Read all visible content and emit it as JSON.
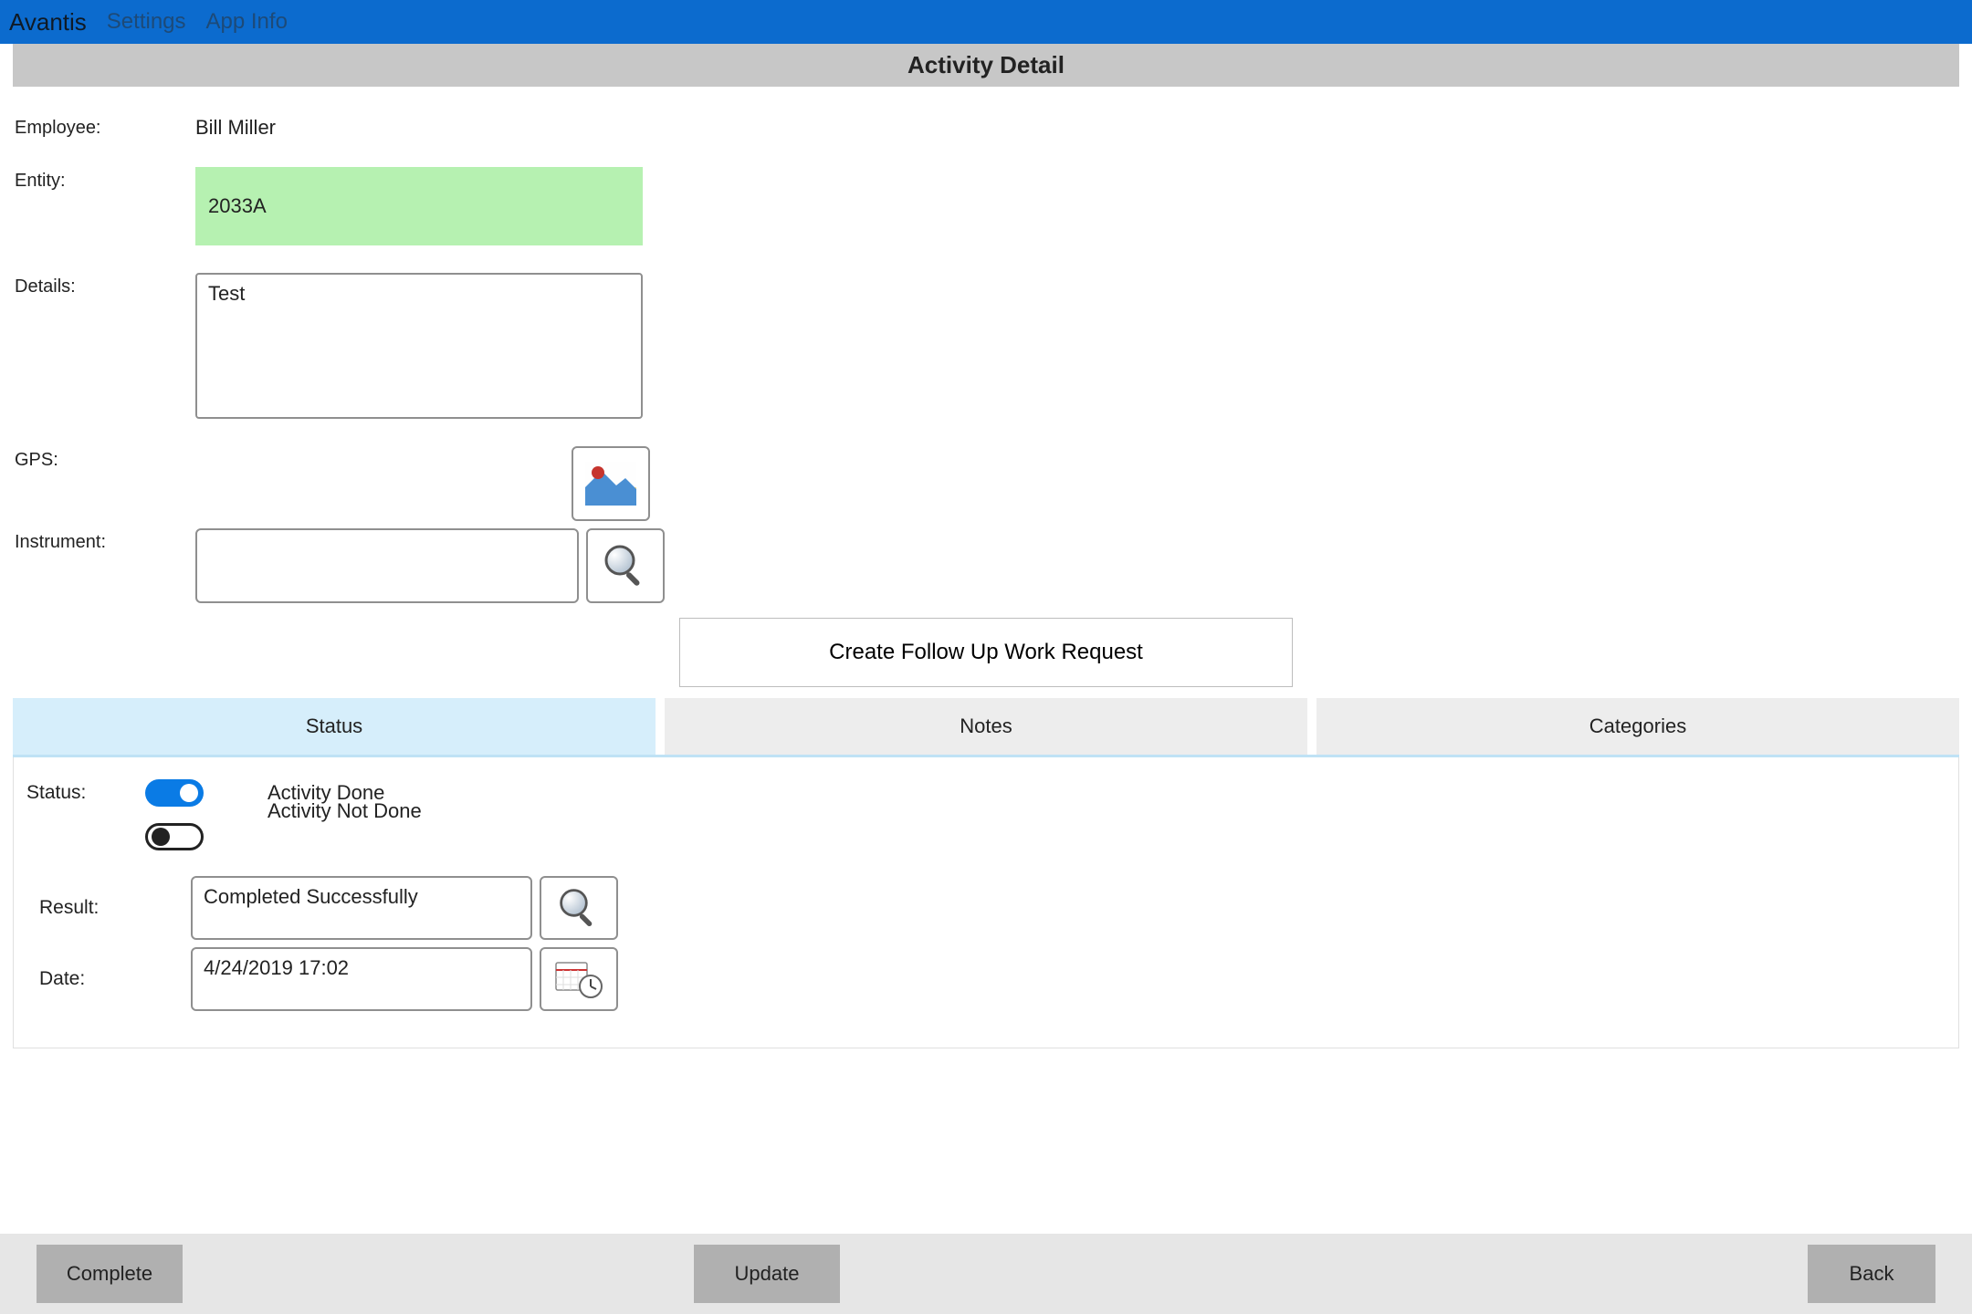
{
  "titlebar": {
    "app": "Avantis",
    "menu_settings": "Settings",
    "menu_appinfo": "App Info"
  },
  "header": {
    "title": "Activity Detail"
  },
  "form": {
    "employee_label": "Employee:",
    "employee_value": "Bill Miller",
    "entity_label": "Entity:",
    "entity_value": "2033A",
    "details_label": "Details:",
    "details_value": "Test",
    "gps_label": "GPS:",
    "instrument_label": "Instrument:",
    "instrument_value": "",
    "followup_label": "Create Follow Up Work Request"
  },
  "tabs": {
    "status": "Status",
    "notes": "Notes",
    "categories": "Categories"
  },
  "status": {
    "label": "Status:",
    "done_text": "Activity Done",
    "notdone_text": "Activity Not Done",
    "result_label": "Result:",
    "result_value": "Completed Successfully",
    "date_label": "Date:",
    "date_value": "4/24/2019 17:02"
  },
  "footer": {
    "complete": "Complete",
    "update": "Update",
    "back": "Back"
  },
  "colors": {
    "titlebar": "#0c6bce",
    "entity_bg": "#b6f1b1",
    "tab_active": "#d6eefb"
  }
}
